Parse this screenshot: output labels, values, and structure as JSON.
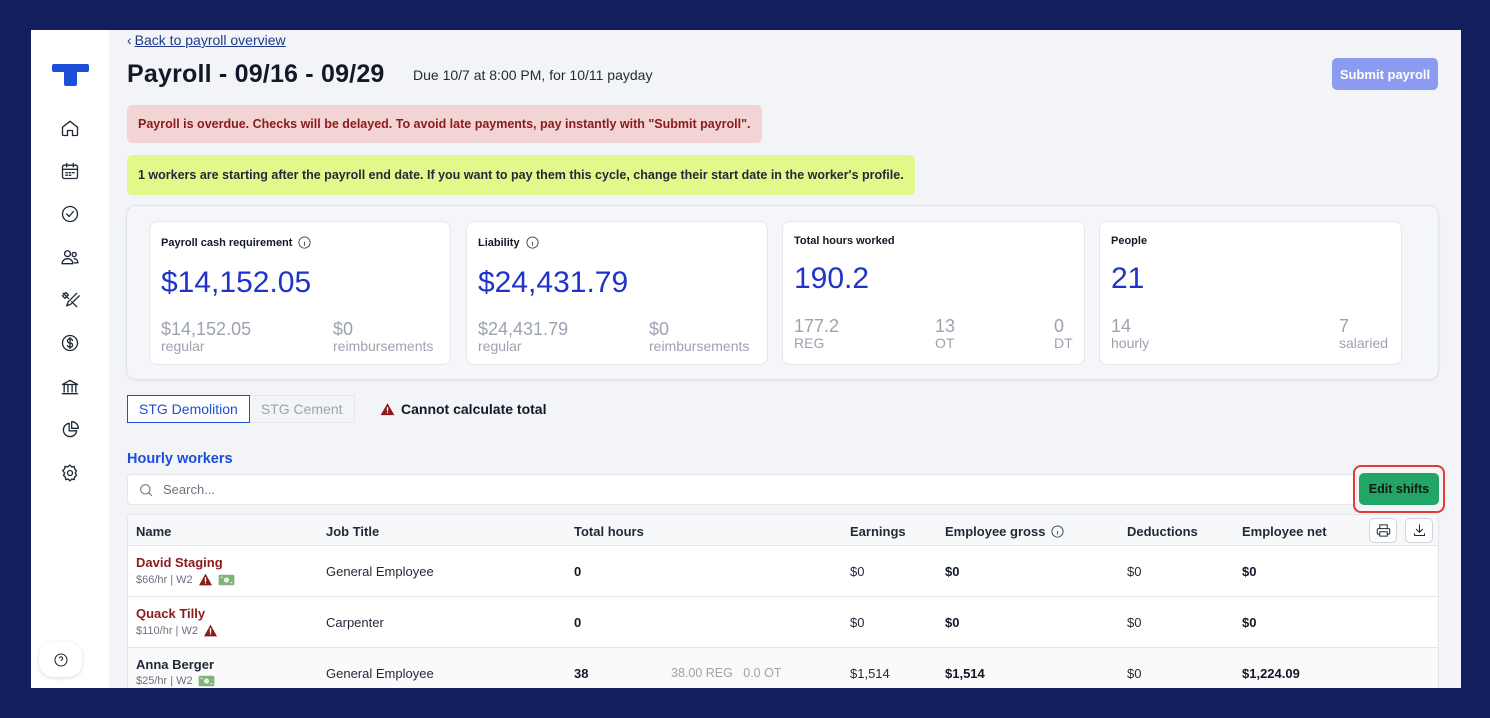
{
  "nav": {
    "back_label": "Back to payroll overview",
    "icons": [
      "home-icon",
      "calendar-icon",
      "check-circle-icon",
      "people-icon",
      "tools-icon",
      "dollar-icon",
      "bank-icon",
      "pie-chart-icon",
      "gear-icon"
    ],
    "help_icon": "question-icon"
  },
  "header": {
    "title": "Payroll - 09/16 - 09/29",
    "due": "Due 10/7 at 8:00 PM, for 10/11 payday",
    "submit_label": "Submit payroll"
  },
  "alerts": {
    "overdue": "Payroll is overdue. Checks will be delayed. To avoid late payments, pay instantly with \"Submit payroll\".",
    "start_date": "1 workers are starting after the payroll end date. If you want to pay them this cycle, change their start date in the worker's profile."
  },
  "stats": {
    "cash": {
      "label": "Payroll cash requirement",
      "value": "$14,152.05",
      "sub1_value": "$14,152.05",
      "sub1_label": "regular",
      "sub2_value": "$0",
      "sub2_label": "reimbursements"
    },
    "liability": {
      "label": "Liability",
      "value": "$24,431.79",
      "sub1_value": "$24,431.79",
      "sub1_label": "regular",
      "sub2_value": "$0",
      "sub2_label": "reimbursements"
    },
    "hours": {
      "label": "Total hours worked",
      "value": "190.2",
      "reg_value": "177.2",
      "reg_label": "REG",
      "ot_value": "13",
      "ot_label": "OT",
      "dt_value": "0",
      "dt_label": "DT"
    },
    "people": {
      "label": "People",
      "value": "21",
      "hourly_value": "14",
      "hourly_label": "hourly",
      "salaried_value": "7",
      "salaried_label": "salaried"
    }
  },
  "tabs": {
    "active": "STG Demolition",
    "inactive": "STG Cement",
    "warning": "Cannot calculate total"
  },
  "section": {
    "title": "Hourly workers",
    "search_placeholder": "Search...",
    "edit_label": "Edit shifts"
  },
  "table": {
    "headers": {
      "name": "Name",
      "job_title": "Job Title",
      "total_hours": "Total hours",
      "earnings": "Earnings",
      "employee_gross": "Employee gross",
      "deductions": "Deductions",
      "employee_net": "Employee net"
    },
    "rows": [
      {
        "name": "David Staging",
        "meta": "$66/hr | W2",
        "job": "General Employee",
        "hours": "0",
        "hours_detail": "",
        "earnings": "$0",
        "gross": "$0",
        "deductions": "$0",
        "net": "$0"
      },
      {
        "name": "Quack Tilly",
        "meta": "$110/hr | W2",
        "job": "Carpenter",
        "hours": "0",
        "hours_detail": "",
        "earnings": "$0",
        "gross": "$0",
        "deductions": "$0",
        "net": "$0"
      },
      {
        "name": "Anna Berger",
        "meta": "$25/hr | W2",
        "job": "General Employee",
        "hours": "38",
        "hours_detail": "38.00 REG   0.0 OT",
        "earnings": "$1,514",
        "gross": "$1,514",
        "deductions": "$0",
        "net": "$1,224.09"
      }
    ]
  },
  "colors": {
    "accent": "#1d4ed8",
    "value_blue": "#1f32c9",
    "alert_red_bg": "#f3d4d4",
    "alert_green_bg": "#e3f88a",
    "edit_green": "#22a565",
    "submit_disabled": "#8b9cf0",
    "warning_red": "#8b1a1a"
  }
}
